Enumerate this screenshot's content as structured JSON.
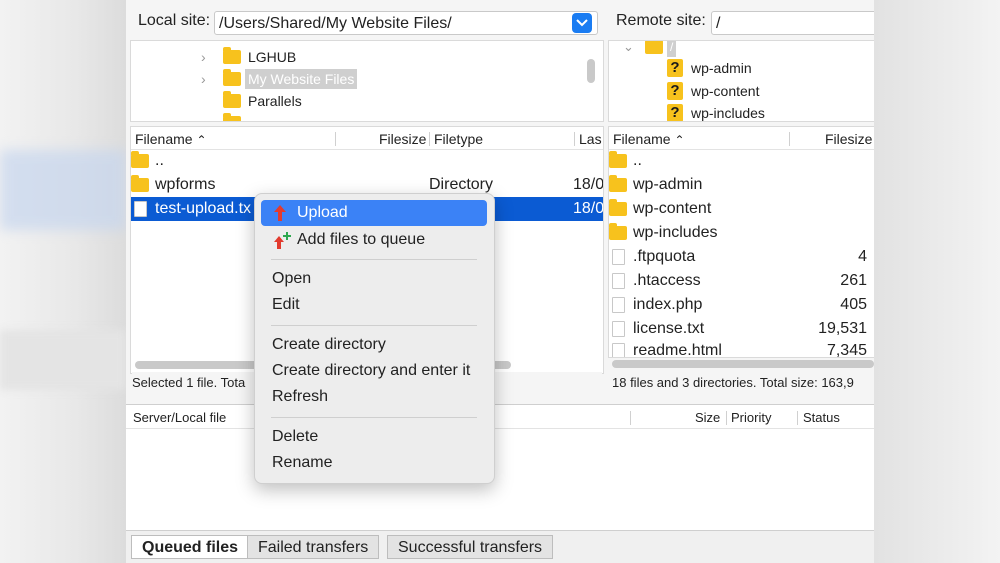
{
  "local": {
    "label": "Local site:",
    "path": "/Users/Shared/My Website Files/",
    "tree": [
      {
        "name": "LGHUB"
      },
      {
        "name": "My Website Files"
      },
      {
        "name": "Parallels"
      }
    ],
    "columns": {
      "filename": "Filename",
      "filesize": "Filesize",
      "filetype": "Filetype",
      "last": "Las"
    },
    "files": [
      {
        "name": "..",
        "type": "",
        "date": ""
      },
      {
        "name": "wpforms",
        "type": "Directory",
        "date": "18/0"
      },
      {
        "name": "test-upload.tx",
        "type": "",
        "date": "18/0"
      }
    ],
    "status": "Selected 1 file. Tota"
  },
  "remote": {
    "label": "Remote site:",
    "path": "/",
    "tree_root": "/",
    "tree": [
      {
        "name": "wp-admin"
      },
      {
        "name": "wp-content"
      },
      {
        "name": "wp-includes"
      }
    ],
    "columns": {
      "filename": "Filename",
      "filesize": "Filesize"
    },
    "files": [
      {
        "name": "..",
        "size": ""
      },
      {
        "name": "wp-admin",
        "size": ""
      },
      {
        "name": "wp-content",
        "size": ""
      },
      {
        "name": "wp-includes",
        "size": ""
      },
      {
        "name": ".ftpquota",
        "size": "4"
      },
      {
        "name": ".htaccess",
        "size": "261"
      },
      {
        "name": "index.php",
        "size": "405"
      },
      {
        "name": "license.txt",
        "size": "19,531"
      },
      {
        "name": "readme.html",
        "size": "7,345"
      }
    ],
    "status": "18 files and 3 directories. Total size: 163,9"
  },
  "queue": {
    "columns": {
      "server_local": "Server/Local file",
      "size": "Size",
      "priority": "Priority",
      "status": "Status"
    }
  },
  "tabs": [
    "Queued files",
    "Failed transfers",
    "Successful transfers"
  ],
  "context_menu": {
    "upload": "Upload",
    "add_to_queue": "Add files to queue",
    "open": "Open",
    "edit": "Edit",
    "create_dir": "Create directory",
    "create_dir_enter": "Create directory and enter it",
    "refresh": "Refresh",
    "delete": "Delete",
    "rename": "Rename"
  },
  "colors": {
    "accent": "#1a7cf2",
    "selection": "#0b5bd3",
    "folder": "#f7c21d",
    "menu_highlight": "#3b82f6"
  }
}
